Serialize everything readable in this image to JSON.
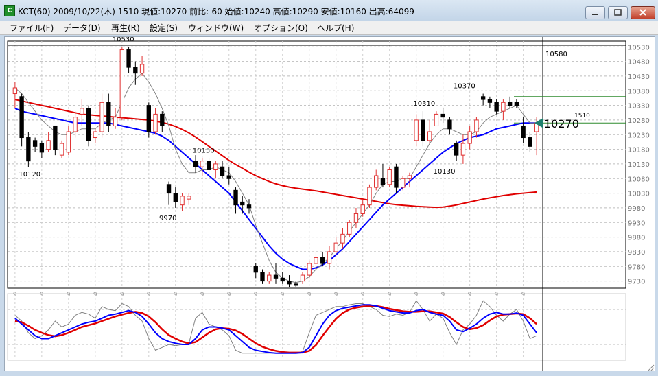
{
  "window": {
    "title": "KCT(60) 2009/10/22(木) 1510 現値:10270 前比:-60 始値:10240 高値:10290 安値:10160 出高:64099",
    "icon_letter": "C"
  },
  "menu": [
    "ファイル(F)",
    "データ(D)",
    "再生(R)",
    "設定(S)",
    "ウィンドウ(W)",
    "オプション(O)",
    "ヘルプ(H)"
  ],
  "chart_data": {
    "type": "candlestick",
    "ylim": [
      9715,
      10540
    ],
    "ytick_labels": [
      "10530",
      "10480",
      "10430",
      "10380",
      "10330",
      "10280",
      "10230",
      "10180",
      "10130",
      "10080",
      "10030",
      "9980",
      "9930",
      "9880",
      "9830",
      "9780",
      "9730"
    ],
    "ytick_values": [
      10530,
      10480,
      10430,
      10380,
      10330,
      10280,
      10230,
      10180,
      10130,
      10080,
      10030,
      9980,
      9930,
      9880,
      9830,
      9780,
      9730
    ],
    "x_tick_label": "9",
    "annotations": [
      {
        "text": "10530",
        "index": 16,
        "value": 10530,
        "pos": "above"
      },
      {
        "text": "10120",
        "index": 2,
        "value": 10120,
        "pos": "below"
      },
      {
        "text": "9970",
        "index": 23,
        "value": 9970,
        "pos": "below"
      },
      {
        "text": "10150",
        "index": 28,
        "value": 10150,
        "pos": "above"
      },
      {
        "text": "10310",
        "index": 61,
        "value": 10310,
        "pos": "above"
      },
      {
        "text": "10370",
        "index": 67,
        "value": 10370,
        "pos": "above"
      },
      {
        "text": "10130",
        "index": 64,
        "value": 10130,
        "pos": "below"
      }
    ],
    "current_price_label": "10270",
    "current_time_label": "1510",
    "upper_marker_label": "10580",
    "level_lines": [
      {
        "value": 10360,
        "color": "#2e8b2e"
      },
      {
        "value": 10270,
        "color": "#2e8b2e"
      }
    ],
    "candles": [
      [
        10370,
        10410,
        10320,
        10390
      ],
      [
        10360,
        10370,
        10190,
        10220
      ],
      [
        10220,
        10240,
        10120,
        10140
      ],
      [
        10210,
        10220,
        10170,
        10190
      ],
      [
        10200,
        10210,
        10150,
        10170
      ],
      [
        10180,
        10240,
        10170,
        10210
      ],
      [
        10260,
        10260,
        10160,
        10180
      ],
      [
        10160,
        10210,
        10150,
        10200
      ],
      [
        10170,
        10260,
        10160,
        10240
      ],
      [
        10240,
        10310,
        10220,
        10290
      ],
      [
        10300,
        10350,
        10260,
        10320
      ],
      [
        10320,
        10330,
        10190,
        10210
      ],
      [
        10220,
        10250,
        10200,
        10240
      ],
      [
        10240,
        10370,
        10220,
        10340
      ],
      [
        10340,
        10370,
        10240,
        10260
      ],
      [
        10260,
        10320,
        10250,
        10290
      ],
      [
        10290,
        10530,
        10280,
        10520
      ],
      [
        10520,
        10530,
        10440,
        10460
      ],
      [
        10460,
        10480,
        10400,
        10440
      ],
      [
        10440,
        10500,
        10430,
        10470
      ],
      [
        10330,
        10340,
        10220,
        10240
      ],
      [
        10240,
        10320,
        10230,
        10300
      ],
      [
        10300,
        10310,
        10240,
        10260
      ],
      [
        10060,
        10070,
        9990,
        10030
      ],
      [
        10030,
        10050,
        9980,
        10000
      ],
      [
        9990,
        10030,
        9970,
        10020
      ],
      [
        10010,
        10030,
        9990,
        10020
      ],
      [
        10140,
        10160,
        10100,
        10120
      ],
      [
        10120,
        10150,
        10090,
        10140
      ],
      [
        10140,
        10150,
        10090,
        10110
      ],
      [
        10110,
        10140,
        10080,
        10130
      ],
      [
        10120,
        10140,
        10080,
        10090
      ],
      [
        10090,
        10120,
        10060,
        10080
      ],
      [
        10040,
        10050,
        9960,
        9990
      ],
      [
        10000,
        10020,
        9960,
        9990
      ],
      [
        9990,
        10010,
        9960,
        9980
      ],
      [
        9780,
        9790,
        9740,
        9760
      ],
      [
        9760,
        9770,
        9720,
        9730
      ],
      [
        9730,
        9760,
        9720,
        9750
      ],
      [
        9750,
        9790,
        9720,
        9740
      ],
      [
        9740,
        9760,
        9720,
        9730
      ],
      [
        9730,
        9750,
        9710,
        9720
      ],
      [
        9720,
        9730,
        9710,
        9715
      ],
      [
        9730,
        9760,
        9720,
        9750
      ],
      [
        9750,
        9800,
        9740,
        9790
      ],
      [
        9790,
        9830,
        9770,
        9810
      ],
      [
        9810,
        9830,
        9780,
        9790
      ],
      [
        9790,
        9850,
        9770,
        9830
      ],
      [
        9830,
        9880,
        9820,
        9860
      ],
      [
        9860,
        9910,
        9840,
        9890
      ],
      [
        9890,
        9940,
        9880,
        9930
      ],
      [
        9930,
        9980,
        9910,
        9960
      ],
      [
        9960,
        10010,
        9950,
        9990
      ],
      [
        9990,
        10060,
        9980,
        10050
      ],
      [
        10050,
        10110,
        10040,
        10090
      ],
      [
        10080,
        10130,
        10050,
        10060
      ],
      [
        10060,
        10120,
        10050,
        10110
      ],
      [
        10120,
        10130,
        10030,
        10050
      ],
      [
        10050,
        10090,
        10040,
        10080
      ],
      [
        10080,
        10100,
        10050,
        10090
      ],
      [
        10210,
        10300,
        10190,
        10280
      ],
      [
        10280,
        10310,
        10190,
        10210
      ],
      [
        10210,
        10280,
        10200,
        10240
      ],
      [
        10260,
        10310,
        10260,
        10300
      ],
      [
        10300,
        10320,
        10270,
        10290
      ],
      [
        10280,
        10290,
        10230,
        10250
      ],
      [
        10200,
        10210,
        10140,
        10160
      ],
      [
        10160,
        10230,
        10130,
        10200
      ],
      [
        10200,
        10260,
        10180,
        10240
      ],
      [
        10240,
        10290,
        10220,
        10280
      ],
      [
        10360,
        10370,
        10330,
        10350
      ],
      [
        10350,
        10360,
        10320,
        10340
      ],
      [
        10340,
        10350,
        10300,
        10310
      ],
      [
        10310,
        10350,
        10280,
        10340
      ],
      [
        10340,
        10360,
        10320,
        10330
      ],
      [
        10340,
        10350,
        10320,
        10330
      ],
      [
        10260,
        10290,
        10200,
        10220
      ],
      [
        10220,
        10240,
        10170,
        10190
      ],
      [
        10240,
        10290,
        10160,
        10270
      ]
    ],
    "ma_short": [
      10390,
      10370,
      10340,
      10310,
      10280,
      10260,
      10240,
      10230,
      10230,
      10240,
      10250,
      10250,
      10250,
      10270,
      10280,
      10290,
      10340,
      10390,
      10420,
      10440,
      10410,
      10370,
      10320,
      10260,
      10180,
      10130,
      10100,
      10100,
      10110,
      10110,
      10120,
      10110,
      10100,
      10070,
      10030,
      9990,
      9920,
      9860,
      9800,
      9760,
      9740,
      9730,
      9725,
      9730,
      9745,
      9770,
      9790,
      9810,
      9840,
      9870,
      9900,
      9930,
      9960,
      9990,
      10030,
      10060,
      10070,
      10070,
      10080,
      10080,
      10120,
      10160,
      10200,
      10230,
      10250,
      10250,
      10240,
      10230,
      10230,
      10240,
      10270,
      10290,
      10300,
      10310,
      10320,
      10330,
      10300,
      10270,
      10270
    ],
    "ma_mid": [
      10320,
      10310,
      10305,
      10300,
      10295,
      10290,
      10285,
      10280,
      10275,
      10270,
      10270,
      10270,
      10270,
      10270,
      10270,
      10265,
      10260,
      10255,
      10250,
      10245,
      10240,
      10235,
      10225,
      10210,
      10190,
      10170,
      10150,
      10130,
      10110,
      10090,
      10070,
      10050,
      10030,
      10000,
      9970,
      9940,
      9910,
      9880,
      9850,
      9825,
      9805,
      9790,
      9780,
      9770,
      9770,
      9775,
      9785,
      9800,
      9820,
      9840,
      9865,
      9890,
      9915,
      9940,
      9965,
      9990,
      10010,
      10030,
      10050,
      10070,
      10090,
      10110,
      10130,
      10150,
      10170,
      10185,
      10200,
      10210,
      10220,
      10225,
      10230,
      10240,
      10250,
      10255,
      10260,
      10265,
      10270,
      10270,
      10270
    ],
    "ma_long": [
      10350,
      10345,
      10340,
      10335,
      10330,
      10325,
      10320,
      10315,
      10310,
      10305,
      10300,
      10298,
      10296,
      10294,
      10292,
      10290,
      10288,
      10286,
      10284,
      10282,
      10280,
      10276,
      10272,
      10266,
      10258,
      10248,
      10236,
      10222,
      10206,
      10190,
      10174,
      10158,
      10142,
      10128,
      10115,
      10102,
      10090,
      10080,
      10070,
      10062,
      10056,
      10051,
      10047,
      10044,
      10041,
      10038,
      10034,
      10030,
      10026,
      10022,
      10018,
      10014,
      10010,
      10006,
      10002,
      9998,
      9994,
      9991,
      9989,
      9987,
      9985,
      9984,
      9983,
      9982,
      9983,
      9986,
      9990,
      9995,
      10000,
      10005,
      10010,
      10014,
      10018,
      10022,
      10025,
      10028,
      10030,
      10032,
      10034
    ],
    "stoch_fast": [
      70,
      60,
      40,
      30,
      35,
      45,
      60,
      50,
      55,
      70,
      75,
      72,
      65,
      85,
      80,
      78,
      90,
      85,
      70,
      60,
      30,
      10,
      15,
      20,
      18,
      20,
      22,
      65,
      75,
      55,
      50,
      45,
      35,
      10,
      5,
      5,
      5,
      5,
      5,
      5,
      5,
      5,
      5,
      8,
      40,
      70,
      75,
      80,
      85,
      85,
      88,
      90,
      90,
      85,
      80,
      70,
      68,
      72,
      70,
      75,
      95,
      80,
      60,
      72,
      65,
      40,
      20,
      45,
      55,
      70,
      95,
      85,
      70,
      60,
      72,
      80,
      60,
      30,
      35
    ],
    "stoch_k": [
      65,
      55,
      45,
      35,
      30,
      30,
      35,
      40,
      45,
      50,
      55,
      58,
      60,
      65,
      70,
      72,
      75,
      78,
      75,
      68,
      55,
      40,
      30,
      25,
      22,
      20,
      20,
      30,
      45,
      50,
      50,
      48,
      45,
      35,
      25,
      15,
      10,
      8,
      6,
      5,
      5,
      5,
      5,
      6,
      15,
      35,
      55,
      70,
      78,
      82,
      84,
      86,
      88,
      88,
      86,
      82,
      78,
      76,
      74,
      74,
      78,
      80,
      75,
      72,
      70,
      60,
      45,
      42,
      48,
      55,
      65,
      72,
      75,
      72,
      72,
      74,
      70,
      55,
      40
    ],
    "stoch_d": [
      60,
      58,
      52,
      45,
      40,
      36,
      34,
      36,
      40,
      45,
      50,
      53,
      56,
      60,
      64,
      68,
      71,
      74,
      76,
      74,
      68,
      58,
      46,
      36,
      30,
      25,
      22,
      24,
      32,
      40,
      46,
      48,
      47,
      44,
      38,
      30,
      22,
      16,
      12,
      9,
      7,
      6,
      6,
      6,
      9,
      19,
      35,
      50,
      64,
      74,
      80,
      83,
      85,
      86,
      86,
      84,
      81,
      79,
      77,
      76,
      76,
      77,
      77,
      75,
      73,
      67,
      58,
      50,
      46,
      48,
      53,
      61,
      68,
      71,
      72,
      73,
      72,
      65,
      55
    ]
  },
  "colors": {
    "up_candle": "#e03030",
    "down_candle": "#000000",
    "ma_short": "#808080",
    "ma_mid": "#0000ff",
    "ma_long": "#e00000",
    "stoch_fast": "#808080",
    "stoch_k": "#0000ff",
    "stoch_d": "#e00000",
    "level_line": "#2e8b2e",
    "price_tag": "#1e7f6e"
  }
}
